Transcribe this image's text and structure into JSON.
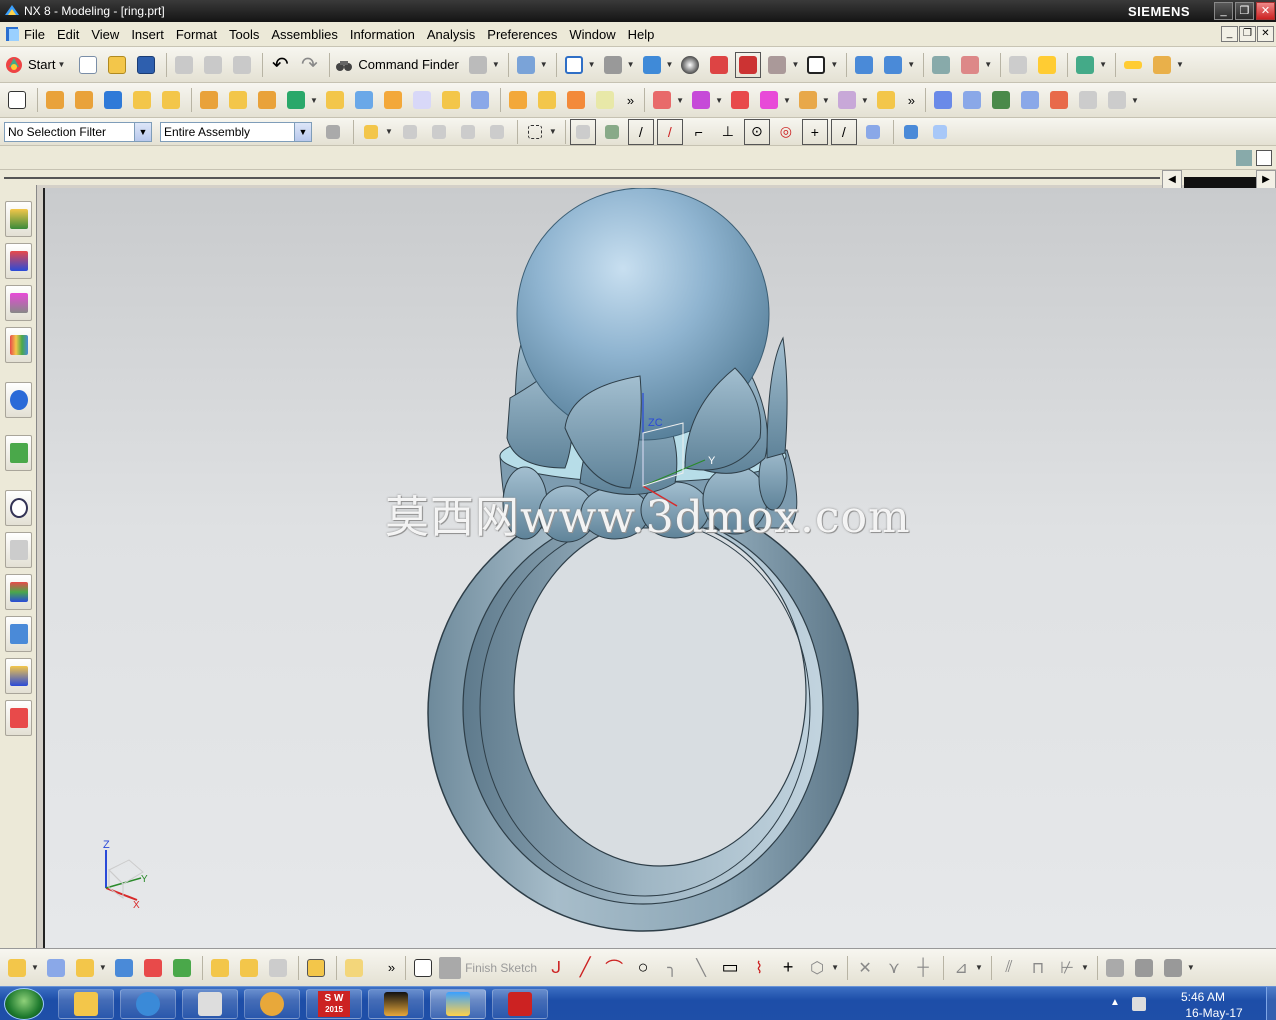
{
  "window": {
    "title": "NX 8 - Modeling - [ring.prt]",
    "brand": "SIEMENS",
    "minimize": "_",
    "maximize": "❐",
    "close": "✕"
  },
  "menu": {
    "items": [
      "File",
      "Edit",
      "View",
      "Insert",
      "Format",
      "Tools",
      "Assemblies",
      "Information",
      "Analysis",
      "Preferences",
      "Window",
      "Help"
    ]
  },
  "toolbar": {
    "start_label": "Start",
    "command_finder_label": "Command Finder",
    "more": "»"
  },
  "filters": {
    "selection_filter": "No Selection Filter",
    "assembly_scope": "Entire Assembly"
  },
  "sketch": {
    "finish_label": "Finish Sketch"
  },
  "viewport": {
    "watermark": "莫西网www.3dmox.com",
    "triad_x": "X",
    "triad_y": "Y",
    "triad_z": "Z",
    "wcs_zc": "ZC",
    "wcs_yc": "Y"
  },
  "taskbar": {
    "time": "5:46 AM",
    "date": "16-May-17",
    "sw_label": "S W",
    "sw_year": "2015"
  },
  "colors": {
    "model": "#8ba7b8",
    "pearl": "#8fb4d0",
    "viewport_top": "#c9cbcd",
    "taskbar": "#1f4fa8"
  }
}
